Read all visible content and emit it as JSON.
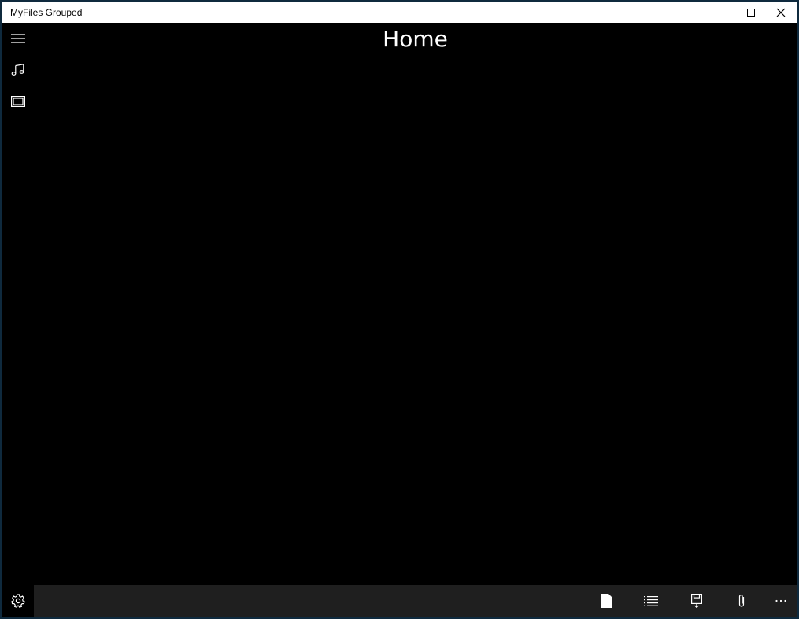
{
  "window": {
    "title": "MyFiles Grouped",
    "controls": {
      "minimize": "minimize-icon",
      "maximize": "maximize-icon",
      "close": "close-icon"
    }
  },
  "sidebar": {
    "items": [
      {
        "icon": "hamburger-menu-icon"
      },
      {
        "icon": "music-icon"
      },
      {
        "icon": "video-icon"
      }
    ],
    "footer": {
      "icon": "gear-icon"
    }
  },
  "page": {
    "title": "Home"
  },
  "commandbar": {
    "buttons": [
      {
        "icon": "document-icon"
      },
      {
        "icon": "list-icon"
      },
      {
        "icon": "save-icon"
      },
      {
        "icon": "paperclip-icon"
      },
      {
        "icon": "more-icon"
      }
    ]
  },
  "colors": {
    "background": "#000000",
    "titlebar": "#ffffff",
    "commandbar": "#1f1f1f",
    "foreground": "#ffffff"
  }
}
